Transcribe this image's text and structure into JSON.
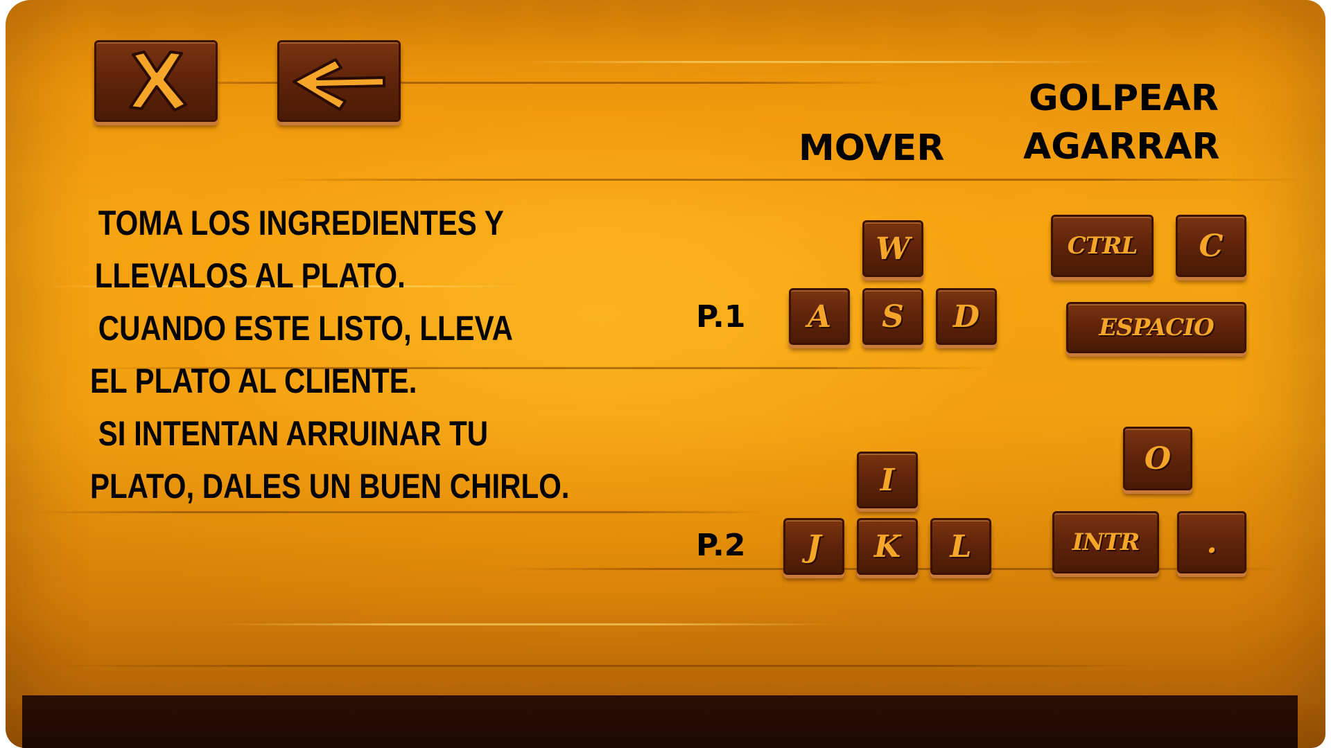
{
  "buttons": {
    "close_label": "X",
    "back_label": "<-"
  },
  "headers": {
    "mover": "MOVER",
    "golpear": "GOLPEAR",
    "agarrar": "AGARRAR"
  },
  "instructions": [
    "TOMA LOS INGREDIENTES Y",
    "LLEVALOS AL PLATO.",
    "CUANDO ESTE LISTO, LLEVA",
    "EL PLATO AL CLIENTE.",
    "SI INTENTAN ARRUINAR TU",
    "PLATO, DALES UN BUEN CHIRLO."
  ],
  "players": {
    "p1": {
      "label": "P.1",
      "move_keys": [
        "W",
        "A",
        "S",
        "D"
      ],
      "hit_keys": [
        "CTRL",
        "C"
      ],
      "grab_key": "ESPACIO"
    },
    "p2": {
      "label": "P.2",
      "move_keys": [
        "I",
        "J",
        "K",
        "L"
      ],
      "hit_key": "O",
      "grab_keys": [
        "INTR",
        "."
      ]
    }
  },
  "colors": {
    "wood_light": "#f5a412",
    "wood_dark": "#5e230a",
    "key_text": "#f5a629",
    "label_text": "#000000"
  }
}
